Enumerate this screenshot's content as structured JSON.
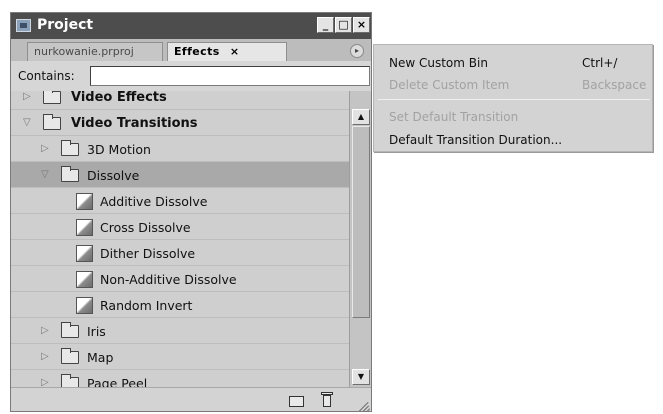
{
  "panel": {
    "title": "Project",
    "window_buttons": {
      "minimize": "_",
      "maximize": "□",
      "close": "×"
    },
    "tabs": [
      {
        "label": "nurkowanie.prproj",
        "active": false
      },
      {
        "label": "Effects",
        "active": true,
        "close": "×"
      }
    ],
    "menu_button": "▸",
    "contains": {
      "label": "Contains:",
      "value": "",
      "placeholder": ""
    }
  },
  "tree": [
    {
      "label": "Video Effects",
      "level": 0,
      "expanded": false,
      "icon": "folder-icon"
    },
    {
      "label": "Video Transitions",
      "level": 0,
      "expanded": true,
      "icon": "folder-icon"
    },
    {
      "label": "3D Motion",
      "level": 1,
      "expanded": false,
      "icon": "folder-icon"
    },
    {
      "label": "Dissolve",
      "level": 1,
      "expanded": true,
      "selected": true,
      "icon": "folder-icon"
    },
    {
      "label": "Additive Dissolve",
      "level": 2,
      "icon": "transition-icon"
    },
    {
      "label": "Cross Dissolve",
      "level": 2,
      "icon": "transition-icon"
    },
    {
      "label": "Dither Dissolve",
      "level": 2,
      "icon": "transition-icon"
    },
    {
      "label": "Non-Additive Dissolve",
      "level": 2,
      "icon": "transition-icon"
    },
    {
      "label": "Random Invert",
      "level": 2,
      "icon": "transition-icon"
    },
    {
      "label": "Iris",
      "level": 1,
      "expanded": false,
      "icon": "folder-icon"
    },
    {
      "label": "Map",
      "level": 1,
      "expanded": false,
      "icon": "folder-icon"
    },
    {
      "label": "Page Peel",
      "level": 1,
      "expanded": false,
      "icon": "folder-icon"
    }
  ],
  "context_menu": {
    "items": [
      {
        "label": "New Custom Bin",
        "shortcut": "Ctrl+/",
        "enabled": true
      },
      {
        "label": "Delete Custom Item",
        "shortcut": "Backspace",
        "enabled": false
      },
      {
        "label": "Set Default Transition",
        "shortcut": "",
        "enabled": false
      },
      {
        "label": "Default Transition Duration...",
        "shortcut": "",
        "enabled": true
      }
    ]
  },
  "colors": {
    "panel_bg": "#d6d6d6",
    "titlebar_bg": "#4d4d4d",
    "selected_row": "#a9a9a9",
    "disabled_text": "#a2a2a2"
  }
}
